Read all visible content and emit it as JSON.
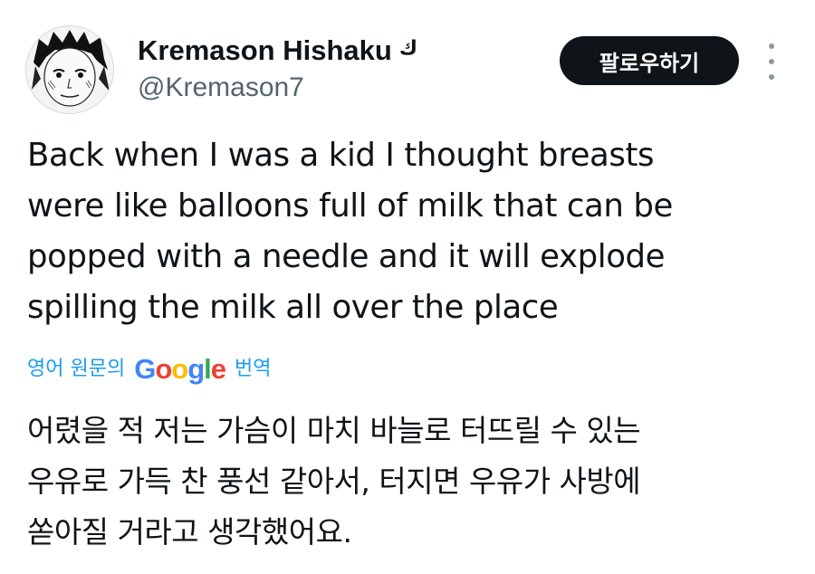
{
  "author": {
    "display_name": "Kremason Hishaku",
    "name_symbol": "ك",
    "handle": "@Kremason7",
    "avatar_icon": "manga-face-avatar"
  },
  "actions": {
    "follow_label": "팔로우하기",
    "more_icon": "more-vertical-icon"
  },
  "tweet": {
    "text": "Back when I was a kid I thought breasts\nwere like balloons full of milk that can be\npopped with a needle and it will explode\nspilling the milk all over the place"
  },
  "translation": {
    "prefix": "영어 원문의",
    "provider_letters": [
      "G",
      "o",
      "o",
      "g",
      "l",
      "e"
    ],
    "suffix": "번역",
    "text": "어렸을 적 저는 가슴이 마치 바늘로 터뜨릴 수 있는\n우유로 가득 찬 풍선 같아서, 터지면 우유가 사방에\n쏟아질 거라고 생각했어요."
  },
  "colors": {
    "link": "#1d9bf0",
    "text": "#0f1419",
    "secondary": "#536471",
    "button_bg": "#0f1419"
  }
}
